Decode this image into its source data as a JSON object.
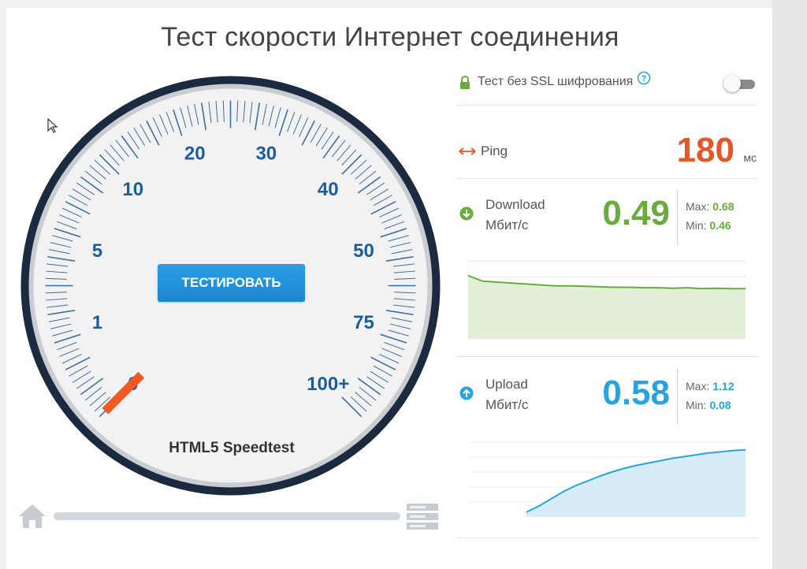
{
  "title": "Тест скорости Интернет соединения",
  "gauge": {
    "scale_labels": [
      "0",
      "1",
      "5",
      "10",
      "20",
      "30",
      "40",
      "50",
      "75",
      "100+"
    ],
    "needle_value": 0,
    "start_button": "ТЕСТИРОВАТЬ",
    "label": "HTML5 Speedtest",
    "progress": 0,
    "colors": {
      "ring": "#1b2a3f",
      "ticks": "#3d6f9e",
      "labels": "#1d5d99",
      "needle": "#f2581f",
      "button": "#1f8fd9"
    }
  },
  "ssl": {
    "label": "Тест без SSL шифрования",
    "help": "?",
    "enabled": false
  },
  "ping": {
    "label": "Ping",
    "value": "180",
    "unit": "мс",
    "color": "#e5572a"
  },
  "download": {
    "label": "Download",
    "unit": "Мбит/с",
    "value": "0.49",
    "max_label": "Max:",
    "max": "0.68",
    "min_label": "Min:",
    "min": "0.46",
    "color": "#6aab3e",
    "chart_data": {
      "type": "area",
      "values": [
        0.68,
        0.62,
        0.61,
        0.6,
        0.59,
        0.58,
        0.57,
        0.57,
        0.565,
        0.56,
        0.555,
        0.555,
        0.55,
        0.55,
        0.545,
        0.55,
        0.54,
        0.545,
        0.54,
        0.54
      ],
      "ylim": [
        0,
        1
      ]
    }
  },
  "upload": {
    "label": "Upload",
    "unit": "Мбит/с",
    "value": "0.58",
    "max_label": "Max:",
    "max": "1.12",
    "min_label": "Min:",
    "min": "0.08",
    "color": "#29a3e0",
    "chart_data": {
      "type": "area",
      "values": [
        0.08,
        0.18,
        0.3,
        0.42,
        0.52,
        0.6,
        0.68,
        0.75,
        0.81,
        0.86,
        0.9,
        0.94,
        0.98,
        1.01,
        1.04,
        1.07,
        1.09,
        1.11,
        1.12
      ],
      "ylim": [
        0,
        1.5
      ]
    }
  }
}
